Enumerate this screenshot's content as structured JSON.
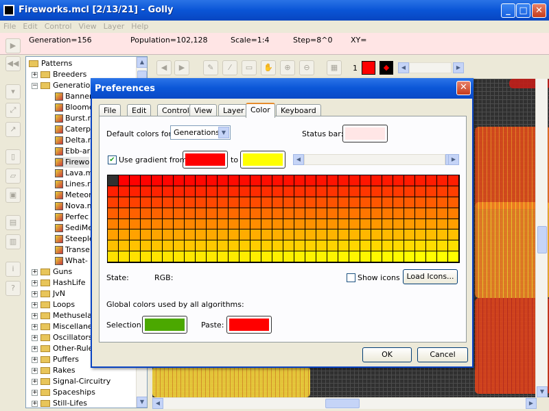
{
  "window": {
    "title": "Fireworks.mcl [2/13/21] - Golly",
    "min": "_",
    "max": "□",
    "close": "✕"
  },
  "menu": [
    "File",
    "Edit",
    "Control",
    "View",
    "Layer",
    "Help"
  ],
  "status": {
    "generation": "Generation=156",
    "population": "Population=102,128",
    "scale": "Scale=1:4",
    "step": "Step=8^0",
    "xy": "XY="
  },
  "tree": {
    "root": "Patterns",
    "folders_top": [
      "Breeders",
      "Generations"
    ],
    "files": [
      "Banner",
      "Bloomer",
      "Burst.mcl",
      "Caterpillars",
      "Delta.mcl",
      "Ebb-and-Flow",
      "Fireworks",
      "Lava.mcl",
      "Lines.mcl",
      "Meteor",
      "Nova.mcl",
      "Perfect",
      "SediMental",
      "Steeple",
      "Transers",
      "What-a"
    ],
    "files_shown": [
      "Banner",
      "Bloome",
      "Burst.r",
      "Caterp",
      "Delta.r",
      "Ebb-ar",
      "Firewo",
      "Lava.m",
      "Lines.r",
      "Meteor",
      "Nova.m",
      "Perfec",
      "SediMe",
      "Steeple",
      "Transe",
      "What-"
    ],
    "folders_bottom": [
      "Guns",
      "HashLife",
      "JvN",
      "Loops",
      "Methuselahs",
      "Miscellaneous",
      "Oscillators",
      "Other-Rules",
      "Puffers",
      "Rakes",
      "Signal-Circuitry",
      "Spaceships",
      "Still-Lifes"
    ],
    "folders_bottom_shown": [
      "Guns",
      "HashLife",
      "JvN",
      "Loops",
      "Methuselal",
      "Miscellane",
      "Oscillators",
      "Other-Rule",
      "Puffers",
      "Rakes",
      "Signal-Circuitry",
      "Spaceships",
      "Still-Lifes"
    ]
  },
  "toolbar": {
    "layer_count": "1",
    "state_color": "#ff0000"
  },
  "dialog": {
    "title": "Preferences",
    "tabs": [
      "File",
      "Edit",
      "Control",
      "View",
      "Layer",
      "Color",
      "Keyboard"
    ],
    "active_tab": "Color",
    "default_colors_label": "Default colors for:",
    "algorithm": "Generations",
    "status_bar_label": "Status bar:",
    "status_bar_color": "#ffe6e6",
    "use_gradient_label": "Use gradient from",
    "use_gradient_checked": true,
    "gradient_from": "#ff0000",
    "gradient_to_label": "to",
    "gradient_to": "#ffff00",
    "state_label": "State:",
    "rgb_label": "RGB:",
    "show_icons_label": "Show icons",
    "load_icons_label": "Load Icons...",
    "global_colors_label": "Global colors used by all algorithms:",
    "selection_label": "Selection:",
    "selection_color": "#4ba800",
    "paste_label": "Paste:",
    "paste_color": "#ff0000",
    "ok_label": "OK",
    "cancel_label": "Cancel",
    "dead_state_color": "#303030"
  }
}
